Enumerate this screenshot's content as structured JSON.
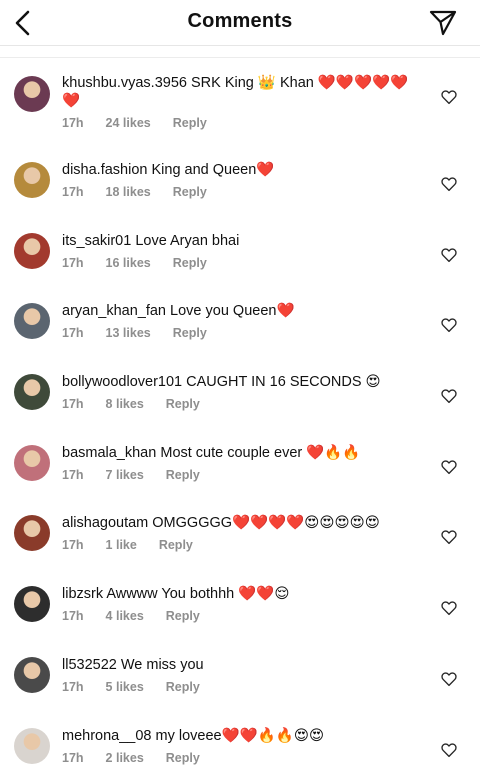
{
  "header": {
    "title": "Comments"
  },
  "comments": [
    {
      "username": "khushbu.vyas.3956",
      "text": "SRK King 👑 Khan ❤️❤️❤️❤️❤️❤️",
      "time": "17h",
      "likes": "24 likes",
      "reply": "Reply",
      "avatar_color": "#6b3a52"
    },
    {
      "username": "disha.fashion",
      "text": "King and Queen❤️",
      "time": "17h",
      "likes": "18 likes",
      "reply": "Reply",
      "avatar_color": "#b58a3c"
    },
    {
      "username": "its_sakir01",
      "text": "Love Aryan bhai",
      "time": "17h",
      "likes": "16 likes",
      "reply": "Reply",
      "avatar_color": "#a23a2e"
    },
    {
      "username": "aryan_khan_fan",
      "text": "Love you Queen❤️",
      "time": "17h",
      "likes": "13 likes",
      "reply": "Reply",
      "avatar_color": "#5b6570"
    },
    {
      "username": "bollywoodlover101",
      "text": "CAUGHT IN 16 SECONDS 😍",
      "time": "17h",
      "likes": "8 likes",
      "reply": "Reply",
      "avatar_color": "#3f4a3a"
    },
    {
      "username": "basmala_khan",
      "text": "Most cute couple ever ❤️🔥🔥",
      "time": "17h",
      "likes": "7 likes",
      "reply": "Reply",
      "avatar_color": "#c0707a"
    },
    {
      "username": "alishagoutam",
      "text": "OMGGGGG❤️❤️❤️❤️😍😍😍😍😍",
      "time": "17h",
      "likes": "1 like",
      "reply": "Reply",
      "avatar_color": "#8a3b2a"
    },
    {
      "username": "libzsrk",
      "text": "Awwww You bothhh ❤️❤️😌",
      "time": "17h",
      "likes": "4 likes",
      "reply": "Reply",
      "avatar_color": "#2d2d2d"
    },
    {
      "username": "ll532522",
      "text": "We miss you",
      "time": "17h",
      "likes": "5 likes",
      "reply": "Reply",
      "avatar_color": "#4a4a4a"
    },
    {
      "username": "mehrona__08",
      "text": "my loveee❤️❤️🔥🔥😍😍",
      "time": "17h",
      "likes": "2 likes",
      "reply": "Reply",
      "avatar_color": "#d9d4cf"
    }
  ]
}
